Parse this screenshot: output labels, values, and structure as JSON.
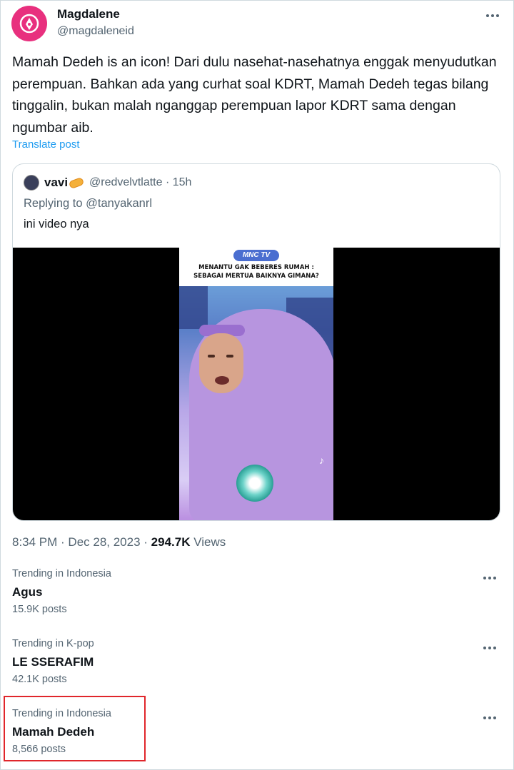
{
  "post": {
    "author_name": "Magdalene",
    "author_handle": "@magdaleneid",
    "text": "Mamah Dedeh is an icon! Dari dulu nasehat-nasehatnya enggak menyudutkan perempuan. Bahkan ada yang curhat soal KDRT, Mamah Dedeh tegas bilang tinggalin, bukan malah nganggap perempuan lapor KDRT sama dengan ngumbar aib.",
    "translate_label": "Translate post",
    "timestamp": "8:34 PM · Dec 28, 2023 · ",
    "views_count": "294.7K",
    "views_label": " Views"
  },
  "quote": {
    "name": "vavi",
    "handle_time": "@redvelvtlatte · 15h",
    "replying_to": "Replying to @tanyakanrl",
    "text": "ini video nya",
    "video": {
      "logo": "MNC TV",
      "headline_line1": "MENANTU GAK BEBERES RUMAH :",
      "headline_line2": "SEBAGAI MERTUA  BAIKNYA GIMANA?"
    }
  },
  "trends": [
    {
      "category": "Trending in Indonesia",
      "name": "Agus",
      "count": "15.9K posts"
    },
    {
      "category": "Trending in K-pop",
      "name": "LE SSERAFIM",
      "count": "42.1K posts"
    },
    {
      "category": "Trending in Indonesia",
      "name": "Mamah Dedeh",
      "count": "8,566 posts"
    }
  ],
  "colors": {
    "accent": "#1d9bf0",
    "avatar": "#e8307e",
    "highlight": "#e0262b"
  }
}
